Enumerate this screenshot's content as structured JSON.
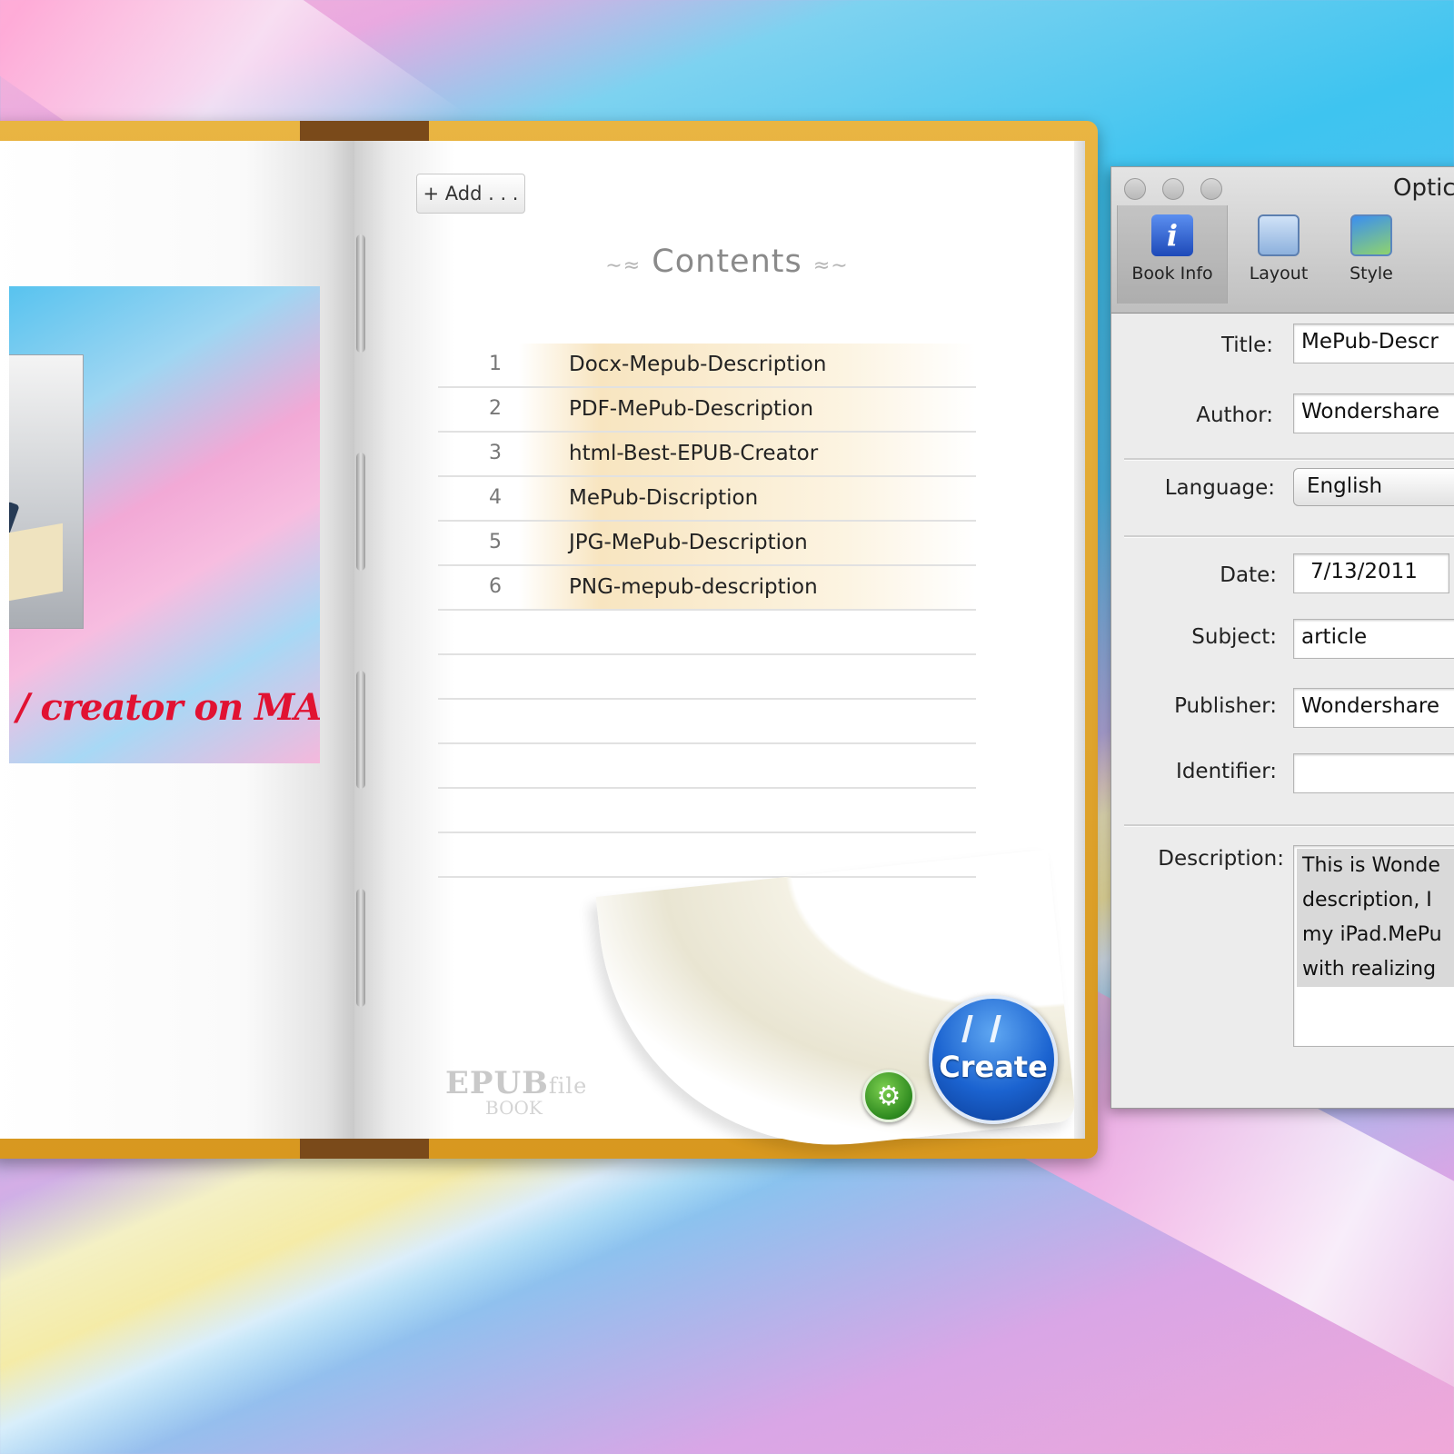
{
  "book": {
    "add_button": "+ Add . . .",
    "contents_title": "Contents",
    "tagline": "/ creator on MAC!",
    "watermark_main": "EPUB",
    "watermark_small": "file",
    "watermark_sub": "BOOK",
    "toc": [
      {
        "num": "1",
        "title": "Docx-Mepub-Description"
      },
      {
        "num": "2",
        "title": "PDF-MePub-Description"
      },
      {
        "num": "3",
        "title": "html-Best-EPUB-Creator"
      },
      {
        "num": "4",
        "title": "MePub-Discription"
      },
      {
        "num": "5",
        "title": "JPG-MePub-Description"
      },
      {
        "num": "6",
        "title": "PNG-mepub-description"
      }
    ],
    "create_label": "Create",
    "gear_icon": "gear-icon"
  },
  "options": {
    "window_title": "Optic",
    "toolbar": [
      {
        "label": "Book Info",
        "icon": "info-icon",
        "selected": true
      },
      {
        "label": "Layout",
        "icon": "layout-icon"
      },
      {
        "label": "Style",
        "icon": "style-icon"
      }
    ],
    "fields": {
      "title_label": "Title:",
      "title_value": "MePub-Descr",
      "author_label": "Author:",
      "author_value": "Wondershare",
      "language_label": "Language:",
      "language_value": "English",
      "date_label": "Date:",
      "date_value": "7/13/2011",
      "subject_label": "Subject:",
      "subject_value": "article",
      "publisher_label": "Publisher:",
      "publisher_value": "Wondershare",
      "identifier_label": "Identifier:",
      "identifier_value": "",
      "description_label": "Description:",
      "description_lines": [
        "This is Wonde",
        "description, I",
        "my iPad.MePu",
        "with realizing"
      ]
    }
  }
}
